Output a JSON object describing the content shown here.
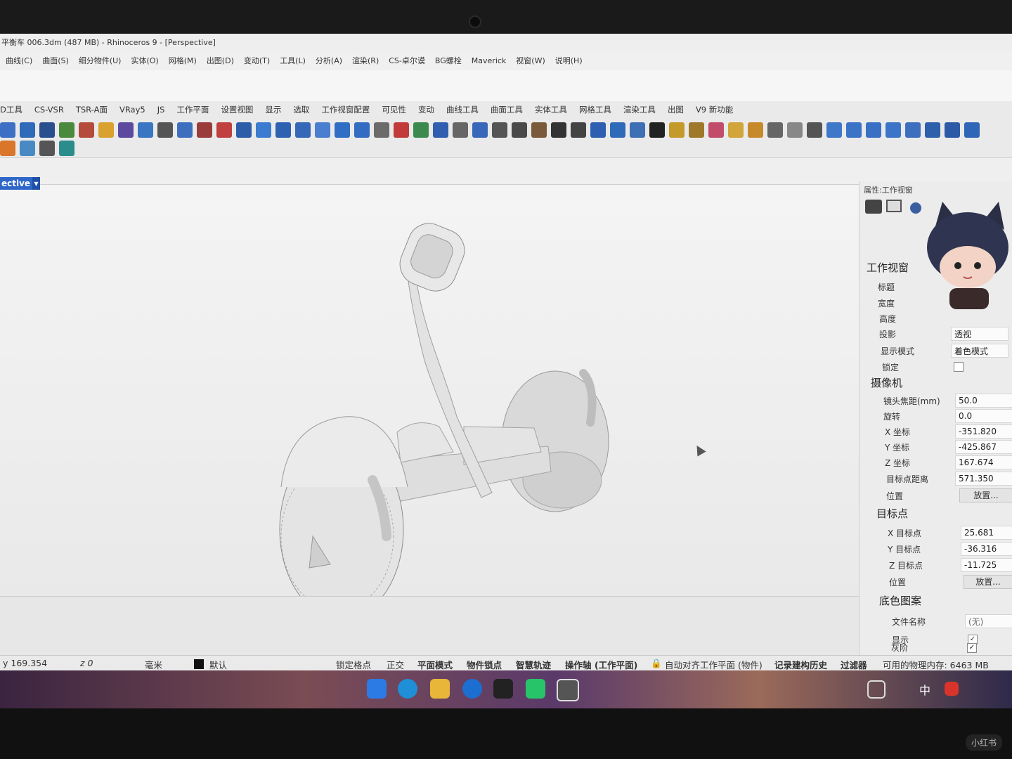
{
  "window": {
    "title": "平衡车 006.3dm (487 MB) - Rhinoceros 9 - [Perspective]"
  },
  "menu": [
    "曲线(C)",
    "曲面(S)",
    "细分物件(U)",
    "实体(O)",
    "网格(M)",
    "出图(D)",
    "变动(T)",
    "工具(L)",
    "分析(A)",
    "渲染(R)",
    "CS-卓尔谟",
    "BG螺栓",
    "Maverick",
    "视窗(W)",
    "说明(H)"
  ],
  "toolbar_tabs": [
    "D工具",
    "CS-VSR",
    "TSR-A面",
    "VRay5",
    "JS",
    "工作平面",
    "设置视图",
    "显示",
    "选取",
    "工作视窗配置",
    "可见性",
    "变动",
    "曲线工具",
    "曲面工具",
    "实体工具",
    "网格工具",
    "渲染工具",
    "出图",
    "V9 新功能"
  ],
  "toolbar_icons": [
    {
      "name": "a",
      "color": "#3d6fc4"
    },
    {
      "name": "b",
      "color": "#2f6bb8"
    },
    {
      "name": "c",
      "color": "#2a4f8f"
    },
    {
      "name": "d",
      "color": "#4b8a3c"
    },
    {
      "name": "e",
      "color": "#b54b3b"
    },
    {
      "name": "f",
      "color": "#d9a230"
    },
    {
      "name": "g",
      "color": "#5b4aa0"
    },
    {
      "name": "h",
      "color": "#3a76c2"
    },
    {
      "name": "i",
      "color": "#555555"
    },
    {
      "name": "j",
      "color": "#3e6fbe"
    },
    {
      "name": "k",
      "color": "#9a3c3c"
    },
    {
      "name": "l",
      "color": "#c04040"
    },
    {
      "name": "m",
      "color": "#2d5da8"
    },
    {
      "name": "n",
      "color": "#3b7bd0"
    },
    {
      "name": "o",
      "color": "#2e62b0"
    },
    {
      "name": "p",
      "color": "#3568b6"
    },
    {
      "name": "q",
      "color": "#4a7fd0"
    },
    {
      "name": "r",
      "color": "#2f6ec4"
    },
    {
      "name": "s",
      "color": "#336cc0"
    },
    {
      "name": "t",
      "color": "#6b6b6b"
    },
    {
      "name": "u",
      "color": "#c23b3b"
    },
    {
      "name": "v",
      "color": "#3d8a4e"
    },
    {
      "name": "w",
      "color": "#2f5fae"
    },
    {
      "name": "x",
      "color": "#666666"
    },
    {
      "name": "y",
      "color": "#3a68b8"
    },
    {
      "name": "z",
      "color": "#555555"
    },
    {
      "name": "aa",
      "color": "#4a4a4a"
    },
    {
      "name": "ab",
      "color": "#7a5a3a"
    },
    {
      "name": "ac",
      "color": "#333333"
    },
    {
      "name": "ad",
      "color": "#444444"
    },
    {
      "name": "ae",
      "color": "#2e5fb0"
    },
    {
      "name": "af",
      "color": "#2f6ab8"
    },
    {
      "name": "ag",
      "color": "#3f6fb5"
    },
    {
      "name": "ah",
      "color": "#222222"
    },
    {
      "name": "ai",
      "color": "#c49a2a"
    },
    {
      "name": "aj",
      "color": "#a0782a"
    },
    {
      "name": "ak",
      "color": "#c24d6a"
    },
    {
      "name": "al",
      "color": "#d1a53a"
    },
    {
      "name": "am",
      "color": "#c78a2a"
    },
    {
      "name": "an",
      "color": "#666666"
    },
    {
      "name": "ao",
      "color": "#888888"
    },
    {
      "name": "ap",
      "color": "#555555"
    },
    {
      "name": "aq",
      "color": "#3f77c9"
    },
    {
      "name": "ar",
      "color": "#3b73c6"
    },
    {
      "name": "as",
      "color": "#3a70c4"
    },
    {
      "name": "at",
      "color": "#3c74c8"
    },
    {
      "name": "au",
      "color": "#3e6fbf"
    },
    {
      "name": "av",
      "color": "#2e5fab"
    },
    {
      "name": "aw",
      "color": "#2c5aa6"
    },
    {
      "name": "ax",
      "color": "#2f66b8"
    }
  ],
  "toolbar_icons_row2": [
    {
      "name": "r2a",
      "color": "#d9762a"
    },
    {
      "name": "r2b",
      "color": "#4a8ac4"
    },
    {
      "name": "r2c",
      "color": "#555555"
    },
    {
      "name": "r2d",
      "color": "#2b8c8c"
    }
  ],
  "viewport": {
    "tab_label": "ective"
  },
  "properties": {
    "header": "属性:工作视窗",
    "viewport_section": "工作视窗",
    "title_label": "标题",
    "width_label": "宽度",
    "height_label": "高度",
    "projection_label": "投影",
    "projection_value": "透视",
    "display_mode_label": "显示模式",
    "display_mode_value": "着色模式",
    "lock_label": "锁定",
    "camera_section": "摄像机",
    "lens_label": "镜头焦距(mm)",
    "lens_value": "50.0",
    "rotation_label": "旋转",
    "rotation_value": "0.0",
    "cam_x_label": "X 坐标",
    "cam_x_value": "-351.820",
    "cam_y_label": "Y 坐标",
    "cam_y_value": "-425.867",
    "cam_z_label": "Z 坐标",
    "cam_z_value": "167.674",
    "target_dist_label": "目标点距离",
    "target_dist_value": "571.350",
    "cam_pos_label": "位置",
    "place_button": "放置...",
    "target_section": "目标点",
    "tgt_x_label": "X 目标点",
    "tgt_x_value": "25.681",
    "tgt_y_label": "Y 目标点",
    "tgt_y_value": "-36.316",
    "tgt_z_label": "Z 目标点",
    "tgt_z_value": "-11.725",
    "tgt_pos_label": "位置",
    "bg_section": "底色图案",
    "filename_label": "文件名称",
    "filename_value": "(无)",
    "show_label": "显示",
    "gray_label": "灰阶"
  },
  "status": {
    "y": "y 169.354",
    "z": "z 0",
    "units": "毫米",
    "layer": "默认",
    "grid_snap": "锁定格点",
    "ortho": "正交",
    "planar": "平面模式",
    "osnap": "物件锁点",
    "smarttrack": "智慧轨迹",
    "gumball": "操作轴 (工作平面)",
    "autocplane": "自动对齐工作平面 (物件)",
    "history": "记录建构历史",
    "filter": "过滤器",
    "memory": "可用的物理内存: 6463 MB"
  },
  "taskbar": {
    "ime": "中"
  },
  "watermark": "小红书"
}
